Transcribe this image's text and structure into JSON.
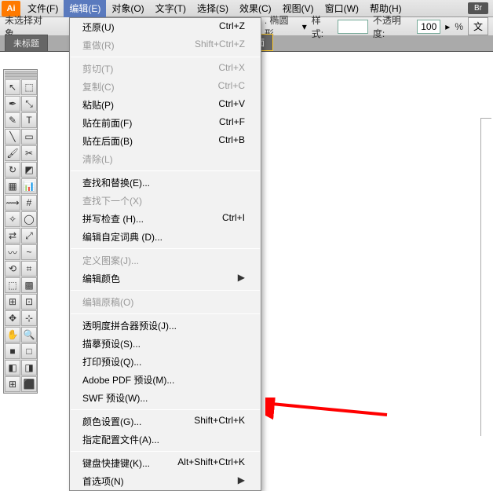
{
  "app": {
    "icon": "Ai",
    "badge": "Br"
  },
  "menubar": {
    "items": [
      {
        "label": "文件(F)"
      },
      {
        "label": "编辑(E)",
        "active": true
      },
      {
        "label": "对象(O)"
      },
      {
        "label": "文字(T)"
      },
      {
        "label": "选择(S)"
      },
      {
        "label": "效果(C)"
      },
      {
        "label": "视图(V)"
      },
      {
        "label": "窗口(W)"
      },
      {
        "label": "帮助(H)"
      }
    ]
  },
  "optionbar": {
    "selection": "未选择对象",
    "shape_label": ". 椭圆形",
    "style_label": "样式:",
    "opacity_label": "不透明度:",
    "opacity_value": "100",
    "pct": "%",
    "text_btn": "文"
  },
  "tabs": {
    "left": "未标题",
    "right": "用户界面"
  },
  "edit_menu": [
    {
      "label": "还原(U)",
      "shortcut": "Ctrl+Z"
    },
    {
      "label": "重做(R)",
      "shortcut": "Shift+Ctrl+Z",
      "disabled": true
    },
    {
      "sep": true
    },
    {
      "label": "剪切(T)",
      "shortcut": "Ctrl+X",
      "disabled": true
    },
    {
      "label": "复制(C)",
      "shortcut": "Ctrl+C",
      "disabled": true
    },
    {
      "label": "粘贴(P)",
      "shortcut": "Ctrl+V"
    },
    {
      "label": "贴在前面(F)",
      "shortcut": "Ctrl+F"
    },
    {
      "label": "贴在后面(B)",
      "shortcut": "Ctrl+B"
    },
    {
      "label": "清除(L)",
      "shortcut": "",
      "disabled": true
    },
    {
      "sep": true
    },
    {
      "label": "查找和替换(E)...",
      "shortcut": ""
    },
    {
      "label": "查找下一个(X)",
      "shortcut": "",
      "disabled": true
    },
    {
      "label": "拼写检查 (H)...",
      "shortcut": "Ctrl+I"
    },
    {
      "label": "编辑自定词典 (D)...",
      "shortcut": ""
    },
    {
      "sep": true
    },
    {
      "label": "定义图案(J)...",
      "shortcut": "",
      "disabled": true
    },
    {
      "label": "编辑颜色",
      "shortcut": "",
      "submenu": true
    },
    {
      "sep": true
    },
    {
      "label": "编辑原稿(O)",
      "shortcut": "",
      "disabled": true
    },
    {
      "sep": true
    },
    {
      "label": "透明度拼合器预设(J)...",
      "shortcut": ""
    },
    {
      "label": "描摹预设(S)...",
      "shortcut": ""
    },
    {
      "label": "打印预设(Q)...",
      "shortcut": ""
    },
    {
      "label": "Adobe PDF 预设(M)...",
      "shortcut": ""
    },
    {
      "label": "SWF 预设(W)...",
      "shortcut": ""
    },
    {
      "sep": true
    },
    {
      "label": "颜色设置(G)...",
      "shortcut": "Shift+Ctrl+K"
    },
    {
      "label": "指定配置文件(A)...",
      "shortcut": ""
    },
    {
      "sep": true
    },
    {
      "label": "键盘快捷键(K)...",
      "shortcut": "Alt+Shift+Ctrl+K"
    },
    {
      "label": "首选项(N)",
      "shortcut": "",
      "submenu": true
    }
  ],
  "tools": [
    "↖",
    "⬚",
    "✒",
    "⤡",
    "✎",
    "T",
    "╲",
    "▭",
    "🖌",
    "✂",
    "↻",
    "◩",
    "▦",
    "📊",
    "⟿",
    "#",
    "✧",
    "◯",
    "⇄",
    "⤢",
    "〰",
    "~",
    "⟲",
    "⌗",
    "⬚",
    "▩",
    "⊞",
    "⊡",
    "✥",
    "⊹",
    "✋",
    "🔍",
    "■",
    "□",
    "◧",
    "◨",
    "⊞",
    "⬛"
  ]
}
